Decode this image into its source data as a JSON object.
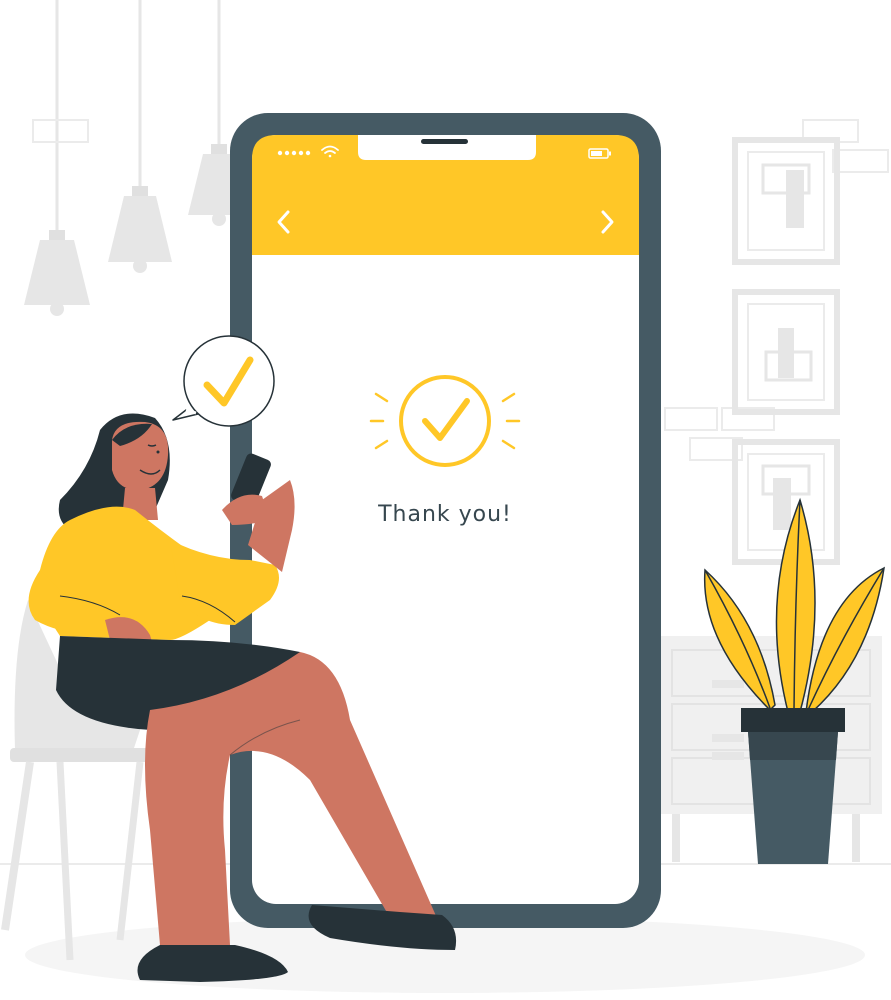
{
  "phone": {
    "status_bar": {
      "signal_icon": "signal-dots-icon",
      "wifi_icon": "wifi-icon",
      "battery_icon": "battery-icon"
    },
    "header": {
      "back_icon": "chevron-left-icon",
      "forward_icon": "chevron-right-icon",
      "color": "#FFC727"
    },
    "screen": {
      "success_icon": "check-circle-icon",
      "message": "Thank you!"
    },
    "frame_color": "#455A64"
  },
  "speech_bubble": {
    "icon": "checkmark-icon"
  },
  "colors": {
    "accent": "#FFC727",
    "dark": "#263238",
    "skin": "#CE7662",
    "background_gray": "#EBEBEB"
  }
}
